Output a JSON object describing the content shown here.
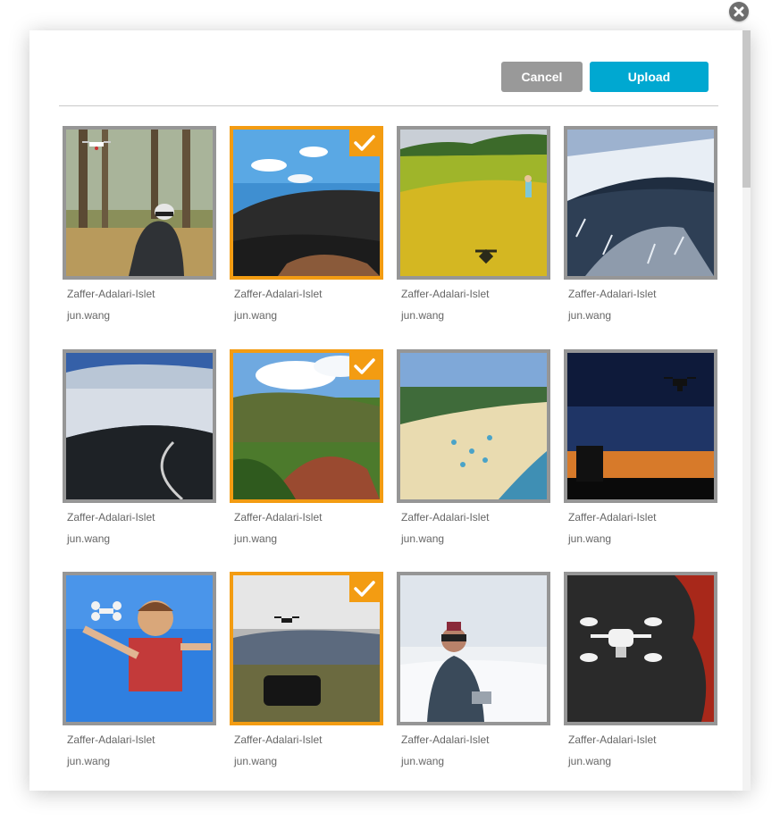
{
  "dialog": {
    "cancel_label": "Cancel",
    "upload_label": "Upload",
    "colors": {
      "accent": "#00a8d1",
      "selected": "#f39c12",
      "cancel": "#999999",
      "thumb_border": "#969696"
    }
  },
  "photos": [
    {
      "title": "Zaffer-Adalari-Islet",
      "author": "jun.wang",
      "selected": false,
      "subject": "mountain biker with drone in forest"
    },
    {
      "title": "Zaffer-Adalari-Islet",
      "author": "jun.wang",
      "selected": true,
      "subject": "dark volcanic hillside under blue sky"
    },
    {
      "title": "Zaffer-Adalari-Islet",
      "author": "jun.wang",
      "selected": false,
      "subject": "child on yellow meadow with drone shadow"
    },
    {
      "title": "Zaffer-Adalari-Islet",
      "author": "jun.wang",
      "selected": false,
      "subject": "snowy forested slope aerial"
    },
    {
      "title": "Zaffer-Adalari-Islet",
      "author": "jun.wang",
      "selected": false,
      "subject": "winter valley with winding road"
    },
    {
      "title": "Zaffer-Adalari-Islet",
      "author": "jun.wang",
      "selected": true,
      "subject": "green ridge and red rocks"
    },
    {
      "title": "Zaffer-Adalari-Islet",
      "author": "jun.wang",
      "selected": false,
      "subject": "aerial beach with umbrellas"
    },
    {
      "title": "Zaffer-Adalari-Islet",
      "author": "jun.wang",
      "selected": false,
      "subject": "drone against sunset sky"
    },
    {
      "title": "Zaffer-Adalari-Islet",
      "author": "jun.wang",
      "selected": false,
      "subject": "child held up with drone, blue sky"
    },
    {
      "title": "Zaffer-Adalari-Islet",
      "author": "jun.wang",
      "selected": true,
      "subject": "people on car with drone overhead"
    },
    {
      "title": "Zaffer-Adalari-Islet",
      "author": "jun.wang",
      "selected": false,
      "subject": "pilot with goggles in snow"
    },
    {
      "title": "Zaffer-Adalari-Islet",
      "author": "jun.wang",
      "selected": false,
      "subject": "white drone on dark ground with red leaves"
    }
  ]
}
